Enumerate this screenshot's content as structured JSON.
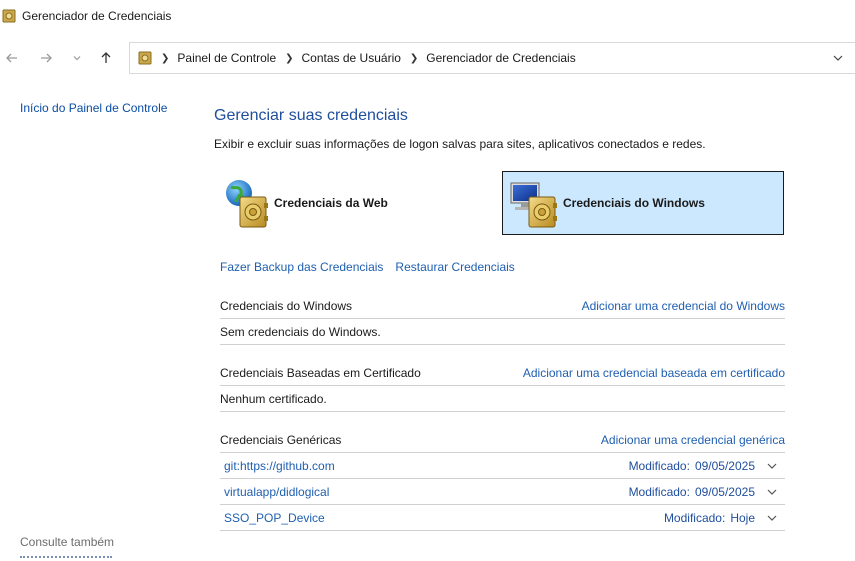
{
  "window": {
    "title": "Gerenciador de Credenciais",
    "icon": "credential-manager-icon"
  },
  "nav": {
    "back_icon": "arrow-left-icon",
    "forward_icon": "arrow-right-icon",
    "recent_icon": "chevron-down-icon",
    "up_icon": "arrow-up-icon"
  },
  "address": {
    "crumbs": [
      "Painel de Controle",
      "Contas de Usuário",
      "Gerenciador de Credenciais"
    ]
  },
  "left_pane": {
    "home_link": "Início do Painel de Controle",
    "see_also": "Consulte também"
  },
  "main": {
    "title": "Gerenciar suas credenciais",
    "description": "Exibir e excluir suas informações de logon salvas para sites, aplicativos conectados e redes.",
    "tiles": {
      "web": "Credenciais da Web",
      "windows": "Credenciais do Windows",
      "selected": "windows"
    },
    "actions": {
      "backup": "Fazer Backup das Credenciais",
      "restore": "Restaurar Credenciais"
    },
    "sections": {
      "windows": {
        "title": "Credenciais do Windows",
        "add": "Adicionar uma credencial do Windows",
        "empty": "Sem credenciais do Windows."
      },
      "certificate": {
        "title": "Credenciais Baseadas em Certificado",
        "add": "Adicionar uma credencial baseada em certificado",
        "empty": "Nenhum certificado."
      },
      "generic": {
        "title": "Credenciais Genéricas",
        "add": "Adicionar uma credencial genérica",
        "items": [
          {
            "name": "git:https://github.com",
            "modified_label": "Modificado:",
            "modified": "09/05/2025"
          },
          {
            "name": "virtualapp/didlogical",
            "modified_label": "Modificado:",
            "modified": "09/05/2025"
          },
          {
            "name": "SSO_POP_Device",
            "modified_label": "Modificado:",
            "modified": "Hoje"
          }
        ]
      }
    }
  },
  "colors": {
    "link": "#1f5fb0",
    "heading": "#1f4e9c",
    "selected_tile": "#cce8ff"
  }
}
